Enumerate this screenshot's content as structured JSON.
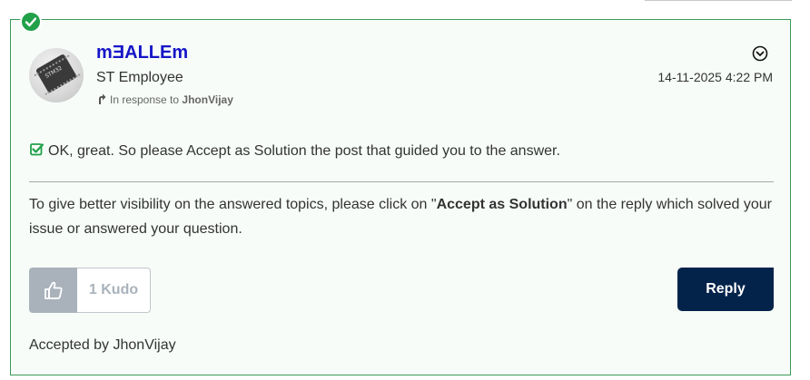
{
  "post": {
    "author": "mƎALLEm",
    "role": "ST Employee",
    "in_response_prefix": "In response to",
    "in_response_to": "JhonVijay",
    "timestamp": "14-11-2025 4:22 PM",
    "message": "OK, great. So please Accept as Solution the post that guided you to the answer.",
    "para_part1": "To give better visibility on the answered topics, please click on \"",
    "para_bold": "Accept as Solution",
    "para_part2": "\" on the reply which solved your issue or answered your question.",
    "kudo_count": "1 Kudo",
    "reply_label": "Reply",
    "accepted_by": "Accepted by JhonVijay"
  },
  "icons": {
    "solved": "check-circle-icon",
    "options": "chevron-circle-icon",
    "response": "reply-arrow-icon",
    "message_check": "checkbox-check-icon",
    "kudo": "thumbs-up-icon"
  },
  "colors": {
    "accent_green": "#22a14a",
    "card_border": "#3b9a57",
    "username": "#1515c8",
    "reply_button": "#03234b",
    "kudo_gray": "#a9b2bb"
  }
}
